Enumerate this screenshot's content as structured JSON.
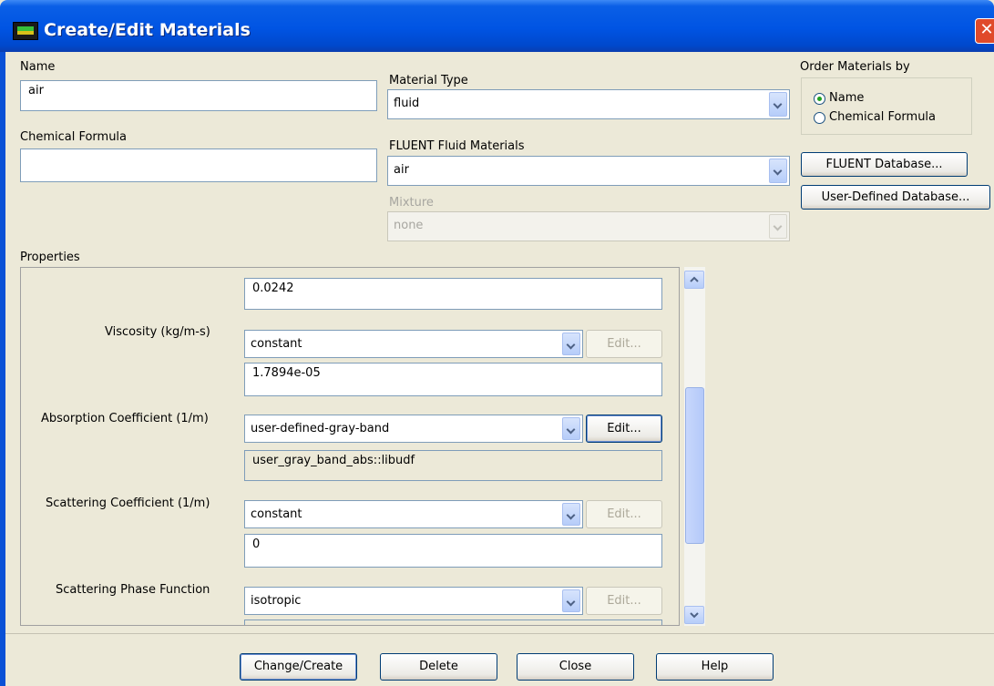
{
  "window": {
    "title": "Create/Edit Materials",
    "close_glyph": "✕"
  },
  "name": {
    "label": "Name",
    "value": "air"
  },
  "chemical_formula": {
    "label": "Chemical Formula",
    "value": ""
  },
  "material_type": {
    "label": "Material Type",
    "value": "fluid"
  },
  "fluent_fluid_materials": {
    "label": "FLUENT Fluid Materials",
    "value": "air"
  },
  "mixture": {
    "label": "Mixture",
    "value": "none"
  },
  "order_by": {
    "label": "Order Materials by",
    "options": [
      "Name",
      "Chemical Formula"
    ],
    "selected": "Name"
  },
  "database_buttons": [
    "FLUENT Database...",
    "User-Defined Database..."
  ],
  "properties": {
    "label": "Properties",
    "top_value": "0.0242",
    "rows": [
      {
        "label": "Viscosity (kg/m-s)",
        "method": "constant",
        "edit": "Edit...",
        "edit_enabled": false,
        "value": "1.7894e-05"
      },
      {
        "label": "Absorption Coefficient (1/m)",
        "method": "user-defined-gray-band",
        "edit": "Edit...",
        "edit_enabled": true,
        "value": "user_gray_band_abs::libudf"
      },
      {
        "label": "Scattering Coefficient (1/m)",
        "method": "constant",
        "edit": "Edit...",
        "edit_enabled": false,
        "value": "0"
      },
      {
        "label": "Scattering Phase Function",
        "method": "isotropic",
        "edit": "Edit...",
        "edit_enabled": false,
        "value": ""
      }
    ]
  },
  "footer_buttons": [
    "Change/Create",
    "Delete",
    "Close",
    "Help"
  ],
  "colors": {
    "titlebar": "#0054e3",
    "dialog_bg": "#ece9d8",
    "close": "#e04a2a"
  }
}
